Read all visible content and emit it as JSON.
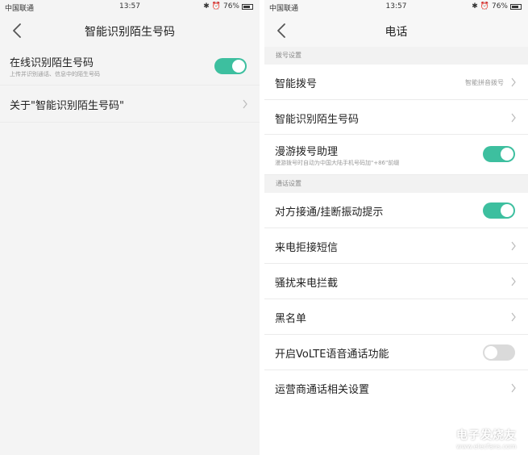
{
  "left": {
    "status": {
      "carrier": "中国联通",
      "time": "13:57",
      "battery": "76%"
    },
    "title": "智能识别陌生号码",
    "rows": [
      {
        "label": "在线识别陌生号码",
        "sub": "上传并识别通话、信息中的陌生号码",
        "toggle": "on"
      },
      {
        "label": "关于\"智能识别陌生号码\""
      }
    ]
  },
  "right": {
    "status": {
      "carrier": "中国联通",
      "time": "13:57",
      "battery": "76%"
    },
    "title": "电话",
    "sections": [
      {
        "header": "拨号设置"
      },
      {
        "header": "通话设置"
      }
    ],
    "rows": [
      {
        "label": "智能拨号",
        "value": "智能拼音拨号"
      },
      {
        "label": "智能识别陌生号码"
      },
      {
        "label": "漫游拨号助理",
        "sub": "漫游拨号时自动为中国大陆手机号码加\"+86\"前缀",
        "toggle": "on"
      },
      {
        "label": "对方接通/挂断振动提示",
        "toggle": "on"
      },
      {
        "label": "来电拒接短信"
      },
      {
        "label": "骚扰来电拦截"
      },
      {
        "label": "黑名单"
      },
      {
        "label": "开启VoLTE语音通话功能",
        "toggle": "off"
      },
      {
        "label": "运营商通话相关设置"
      }
    ]
  },
  "watermark": {
    "cn": "电子发烧友",
    "en": "www.elecfans.com"
  },
  "colors": {
    "accent": "#3dbf9f",
    "toggle_off": "#dadada",
    "section_bg": "#f2f2f2"
  }
}
